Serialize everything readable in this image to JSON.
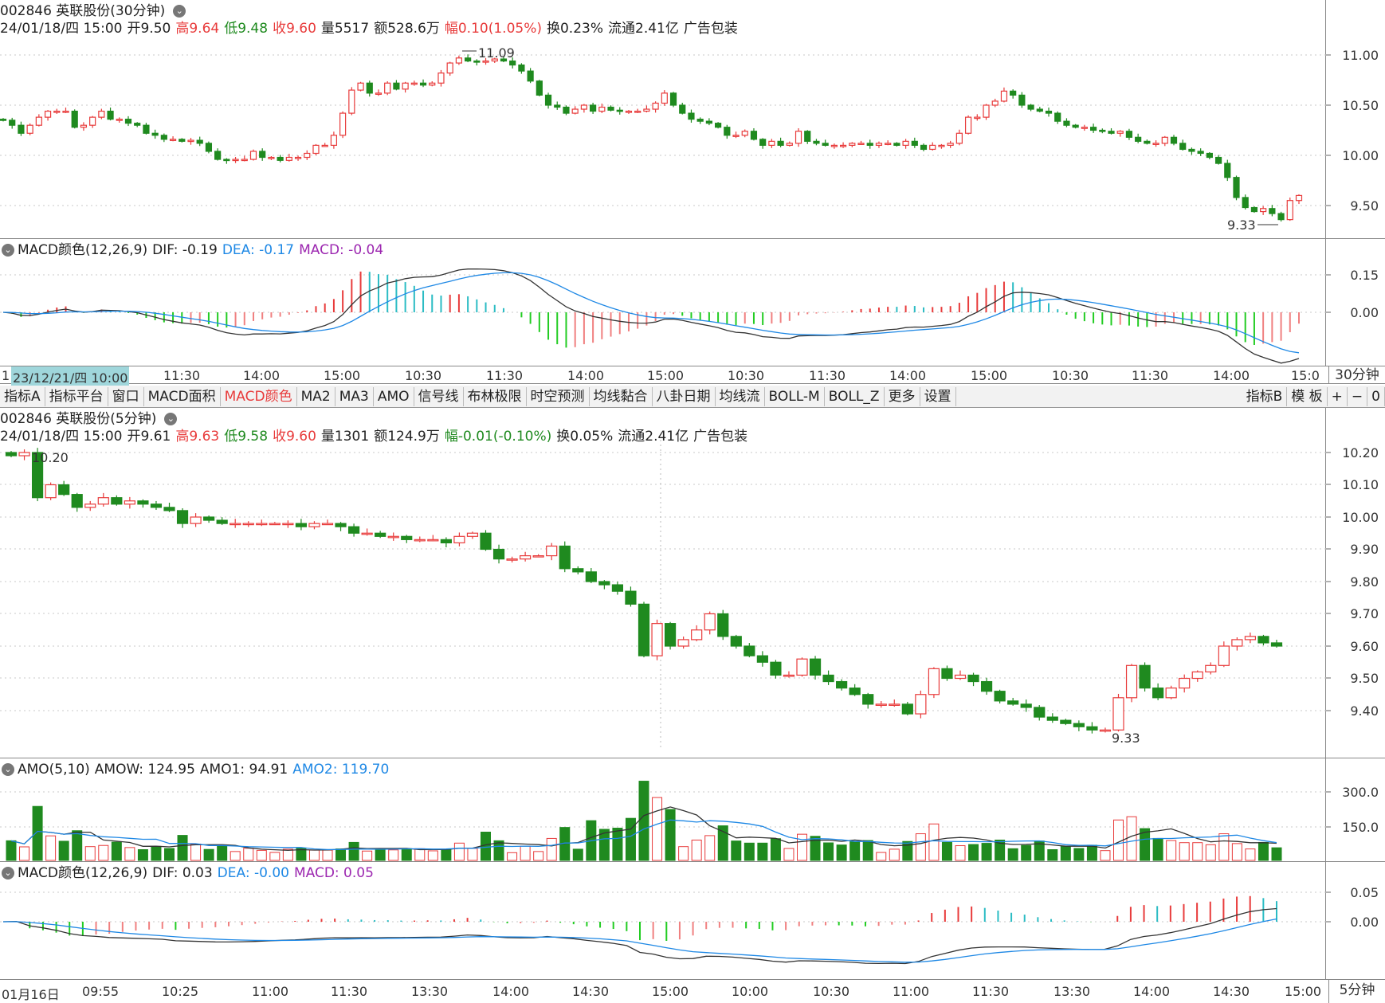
{
  "top": {
    "title": "002846 英联股份(30分钟)",
    "info": {
      "date": "24/01/18/四 15:00",
      "open_label": "开",
      "open": "9.50",
      "high_label": "高",
      "high": "9.64",
      "low_label": "低",
      "low": "9.48",
      "close_label": "收",
      "close": "9.60",
      "vol_label": "量",
      "vol": "5517",
      "amt_label": "额",
      "amt": "528.6万",
      "chg_label": "幅",
      "chg": "0.10(1.05%)",
      "turn": "换0.23%",
      "float": "流通2.41亿",
      "industry": "广告包装"
    },
    "yticks": [
      "11.00",
      "10.50",
      "10.00",
      "9.50"
    ],
    "max_label": "11.09",
    "min_label": "9.33"
  },
  "top_macd": {
    "title": "MACD颜色(12,26,9)",
    "dif": "DIF: -0.19",
    "dea": "DEA: -0.17",
    "macd": "MACD: -0.04",
    "yticks": [
      "0.15",
      "0.00"
    ]
  },
  "top_time": {
    "cursor_label": "23/12/21/四 10:00",
    "first_label": "1",
    "labels": [
      "11:30",
      "14:00",
      "15:00",
      "10:30",
      "11:30",
      "14:00",
      "15:00",
      "10:30",
      "11:30",
      "14:00",
      "15:00",
      "10:30",
      "11:30",
      "14:00",
      "15:0"
    ],
    "period": "30分钟"
  },
  "toolbar": {
    "buttons": [
      "指标A",
      "指标平台",
      "窗口",
      "MACD面积",
      "MACD颜色",
      "MA2",
      "MA3",
      "AMO",
      "信号线",
      "布林极限",
      "时空预测",
      "均线黏合",
      "八卦日期",
      "均线流",
      "BOLL-M",
      "BOLL_Z",
      "更多",
      "设置"
    ],
    "right_buttons": [
      "指标B",
      "模 板",
      "+",
      "−",
      "0"
    ]
  },
  "bottom": {
    "title": "002846 英联股份(5分钟)",
    "info": {
      "date": "24/01/18/四 15:00",
      "open_label": "开",
      "open": "9.61",
      "high_label": "高",
      "high": "9.63",
      "low_label": "低",
      "low": "9.58",
      "close_label": "收",
      "close": "9.60",
      "vol_label": "量",
      "vol": "1301",
      "amt_label": "额",
      "amt": "124.9万",
      "chg_label": "幅",
      "chg": "-0.01(-0.10%)",
      "turn": "换0.05%",
      "float": "流通2.41亿",
      "industry": "广告包装"
    },
    "yticks": [
      "10.20",
      "10.10",
      "10.00",
      "9.90",
      "9.80",
      "9.70",
      "9.60",
      "9.50",
      "9.40"
    ],
    "max_label": "10.20",
    "min_label": "9.33"
  },
  "amo": {
    "title": "AMO(5,10)",
    "amow": "AMOW: 124.95",
    "amo1": "AMO1: 94.91",
    "amo2": "AMO2: 119.70",
    "yticks": [
      "300.0",
      "150.0"
    ]
  },
  "bot_macd": {
    "title": "MACD颜色(12,26,9)",
    "dif": "DIF: 0.03",
    "dea": "DEA: -0.00",
    "macd": "MACD: 0.05",
    "yticks": [
      "0.05",
      "0.00"
    ]
  },
  "bot_time": {
    "labels": [
      "01月16日",
      "09:55",
      "10:25",
      "11:00",
      "11:30",
      "13:30",
      "14:00",
      "14:30",
      "15:00",
      "10:00",
      "10:30",
      "11:00",
      "11:30",
      "13:30",
      "14:00",
      "14:30",
      "15:00"
    ],
    "period": "5分钟"
  },
  "colors": {
    "up": "#e83b3b",
    "down": "#1f8a1f",
    "dif": "#333333",
    "dea": "#1e88e5",
    "cyan": "#2bbcc4"
  },
  "chart_data": [
    {
      "type": "candlestick",
      "title": "002846 英联股份(30分钟)",
      "ylim": [
        9.25,
        11.15
      ],
      "closes": [
        10.35,
        10.3,
        10.22,
        10.3,
        10.38,
        10.44,
        10.44,
        10.44,
        10.28,
        10.3,
        10.38,
        10.44,
        10.36,
        10.36,
        10.32,
        10.3,
        10.22,
        10.2,
        10.16,
        10.16,
        10.14,
        10.15,
        10.12,
        10.04,
        9.96,
        9.95,
        9.96,
        9.96,
        10.04,
        9.98,
        9.98,
        9.95,
        9.98,
        9.98,
        10.02,
        10.1,
        10.1,
        10.2,
        10.42,
        10.65,
        10.72,
        10.62,
        10.62,
        10.72,
        10.66,
        10.72,
        10.72,
        10.7,
        10.72,
        10.82,
        10.92,
        10.97,
        10.94,
        10.93,
        10.94,
        10.96,
        10.94,
        10.9,
        10.84,
        10.74,
        10.6,
        10.5,
        10.48,
        10.42,
        10.46,
        10.5,
        10.44,
        10.48,
        10.45,
        10.44,
        10.44,
        10.44,
        10.46,
        10.52,
        10.62,
        10.5,
        10.42,
        10.36,
        10.34,
        10.32,
        10.28,
        10.2,
        10.2,
        10.24,
        10.16,
        10.1,
        10.14,
        10.1,
        10.12,
        10.24,
        10.14,
        10.12,
        10.1,
        10.1,
        10.1,
        10.12,
        10.12,
        10.1,
        10.12,
        10.12,
        10.1,
        10.14,
        10.1,
        10.06,
        10.1,
        10.1,
        10.12,
        10.22,
        10.38,
        10.38,
        10.5,
        10.54,
        10.64,
        10.6,
        10.5,
        10.46,
        10.44,
        10.42,
        10.34,
        10.3,
        10.28,
        10.28,
        10.25,
        10.24,
        10.22,
        10.24,
        10.18,
        10.14,
        10.12,
        10.12,
        10.18,
        10.12,
        10.06,
        10.04,
        10.02,
        9.98,
        9.92,
        9.78,
        9.58,
        9.48,
        9.44,
        9.47,
        9.42,
        9.36,
        9.55,
        9.6
      ]
    },
    {
      "type": "line",
      "title": "MACD颜色(12,26,9)",
      "series": [
        {
          "name": "DIF",
          "last": -0.19
        },
        {
          "name": "DEA",
          "last": -0.17
        },
        {
          "name": "MACD",
          "last": -0.04
        }
      ],
      "ylim": [
        -0.15,
        0.2
      ]
    },
    {
      "type": "candlestick",
      "title": "002846 英联股份(5分钟)",
      "ylim": [
        9.3,
        10.22
      ],
      "closes": [
        10.19,
        10.2,
        10.06,
        10.1,
        10.07,
        10.03,
        10.04,
        10.06,
        10.04,
        10.05,
        10.04,
        10.03,
        10.02,
        9.98,
        10,
        9.99,
        9.98,
        9.98,
        9.98,
        9.98,
        9.98,
        9.98,
        9.97,
        9.98,
        9.98,
        9.97,
        9.95,
        9.95,
        9.94,
        9.94,
        9.93,
        9.93,
        9.93,
        9.92,
        9.94,
        9.95,
        9.9,
        9.87,
        9.87,
        9.88,
        9.88,
        9.91,
        9.84,
        9.83,
        9.8,
        9.79,
        9.77,
        9.73,
        9.57,
        9.67,
        9.6,
        9.62,
        9.65,
        9.7,
        9.63,
        9.6,
        9.57,
        9.55,
        9.51,
        9.51,
        9.56,
        9.51,
        9.49,
        9.47,
        9.45,
        9.42,
        9.42,
        9.42,
        9.39,
        9.45,
        9.53,
        9.5,
        9.51,
        9.49,
        9.46,
        9.43,
        9.42,
        9.41,
        9.38,
        9.37,
        9.36,
        9.35,
        9.34,
        9.34,
        9.44,
        9.54,
        9.47,
        9.44,
        9.47,
        9.5,
        9.52,
        9.54,
        9.6,
        9.62,
        9.63,
        9.61,
        9.6
      ]
    },
    {
      "type": "bar",
      "title": "AMO(5,10)",
      "series": [
        {
          "name": "AMOW",
          "last": 124.95
        },
        {
          "name": "AMO1",
          "last": 94.91
        },
        {
          "name": "AMO2",
          "last": 119.7
        }
      ],
      "ylim": [
        0,
        370
      ]
    },
    {
      "type": "line",
      "title": "MACD颜色(12,26,9)",
      "series": [
        {
          "name": "DIF",
          "last": 0.03
        },
        {
          "name": "DEA",
          "last": -0.0
        },
        {
          "name": "MACD",
          "last": 0.05
        }
      ],
      "ylim": [
        -0.1,
        0.07
      ]
    }
  ]
}
